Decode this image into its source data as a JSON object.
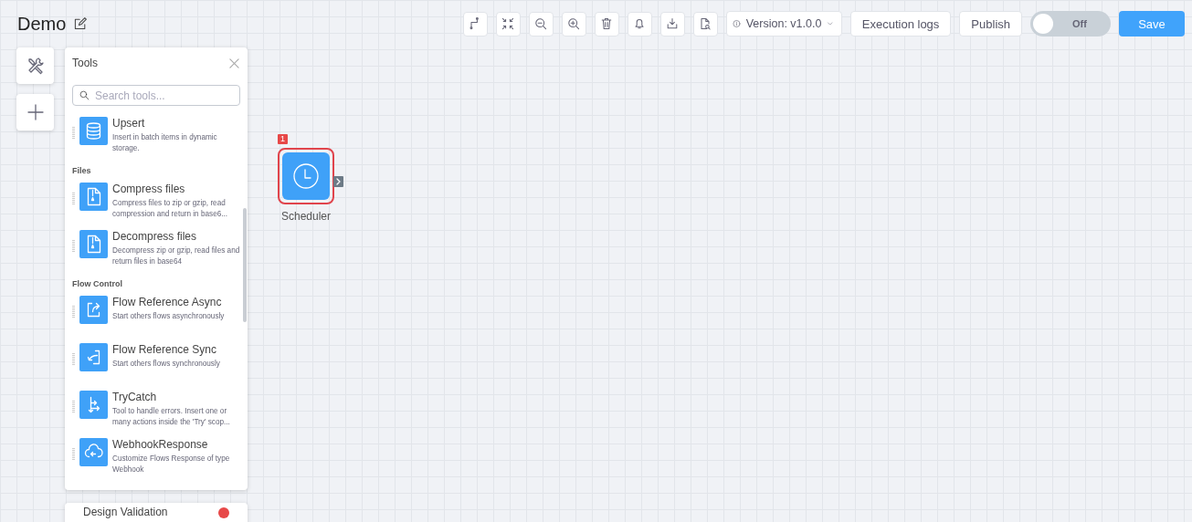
{
  "title": "Demo",
  "toolbar": {
    "version": "Version: v1.0.0",
    "buttons": [
      "Execution logs",
      "Publish"
    ],
    "toggle": {
      "label": "Off",
      "on": false
    },
    "save": "Save"
  },
  "tools_panel": {
    "title": "Tools",
    "search": {
      "placeholder": "Search tools..."
    },
    "items": [
      {
        "kind": "tool",
        "name": "Upsert",
        "description": "Insert in batch items in dynamic storage."
      },
      {
        "kind": "section",
        "name": "Files"
      },
      {
        "kind": "tool",
        "name": "Compress files",
        "description": "Compress files to zip or gzip, read compression and return in base6..."
      },
      {
        "kind": "tool",
        "name": "Decompress files",
        "description": "Decompress zip or gzip, read files and return files in base64"
      },
      {
        "kind": "section",
        "name": "Flow Control"
      },
      {
        "kind": "tool",
        "name": "Flow Reference Async",
        "description": "Start others flows asynchronously"
      },
      {
        "kind": "tool",
        "name": "Flow Reference Sync",
        "description": "Start others flows synchronously"
      },
      {
        "kind": "tool",
        "name": "TryCatch",
        "description": "Tool to handle errors. Insert one or many actions inside the 'Try' scop..."
      },
      {
        "kind": "tool",
        "name": "WebhookResponse",
        "description": "Customize Flows Response of type Webhook"
      }
    ]
  },
  "node": {
    "label": "Scheduler",
    "badge": "1",
    "selected": true
  },
  "validation_panel": {
    "title": "Design Validation"
  }
}
